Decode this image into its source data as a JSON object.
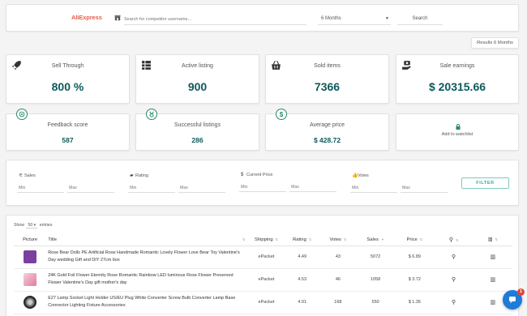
{
  "topbar": {
    "brand": "AliExpress",
    "search_placeholder": "Search for competitor username...",
    "period": "6 Months",
    "search_label": "Search"
  },
  "results_badge": "Results 6 Months",
  "stats_top": [
    {
      "title": "Sell Through",
      "value": "800 %",
      "icon": "rocket-icon"
    },
    {
      "title": "Active listing",
      "value": "900",
      "icon": "grid-list-icon"
    },
    {
      "title": "Sold items",
      "value": "7366",
      "icon": "basket-icon"
    },
    {
      "title": "Sale earnings",
      "value": "$ 20315.66",
      "icon": "money-hand-icon"
    }
  ],
  "stats_bottom": [
    {
      "title": "Feedback score",
      "value": "587",
      "icon": "star-badge-icon"
    },
    {
      "title": "Successful listings",
      "value": "286",
      "icon": "medal-icon"
    },
    {
      "title": "Average price",
      "value": "$ 428.72",
      "icon": "dollar-icon"
    }
  ],
  "watchlist": {
    "label": "Add to watchlist",
    "icon": "lock-icon"
  },
  "filters": {
    "groups": [
      {
        "label": "Sales",
        "icon": "sliders-icon",
        "min": "Min",
        "max": "Max"
      },
      {
        "label": "Rating",
        "icon": "ticket-icon",
        "min": "Min",
        "max": "Max"
      },
      {
        "label": "Current Price",
        "icon": "dollar-icon",
        "min": "Min",
        "max": "Max"
      },
      {
        "label": "Votes",
        "icon": "thumb-icon",
        "min": "Min",
        "max": "Max"
      }
    ],
    "button_label": "FILTER"
  },
  "table": {
    "show_prefix": "Show",
    "show_value": "50",
    "show_suffix": "entries",
    "columns": [
      "Picture",
      "Title",
      "Shipping",
      "Rating",
      "Votes",
      "Sales",
      "Price"
    ],
    "rows": [
      {
        "thumb_color": "#7b3fa0",
        "title": "Rose Bear Dolls PE Artificial Rose Handmade Romantic Lovely Flower Love Bear Toy Valentine's Day wedding Gift and DIY 27cm box",
        "shipping": "ePacket",
        "rating": "4.49",
        "votes": "43",
        "sales": "5072",
        "price": "$ 6.89"
      },
      {
        "thumb_color": "#e8a6b8",
        "title": "24K Gold Foil Flower Eternity Rose Romantic Rainbow LED luminous Rose Flower Preserved Flower Valentine's Day gift mother's day",
        "shipping": "ePacket",
        "rating": "4.53",
        "votes": "46",
        "sales": "1058",
        "price": "$ 3.72"
      },
      {
        "thumb_color": "#333333",
        "title": "E27 Lamp Socket Light Holder US/EU Plug White Converter Screw Bulb Converter Lamp Base Connector Lighting Fixture Accessories",
        "shipping": "ePacket",
        "rating": "4.91",
        "votes": "168",
        "sales": "550",
        "price": "$ 1.35"
      }
    ]
  },
  "chat": {
    "badge": "1"
  }
}
